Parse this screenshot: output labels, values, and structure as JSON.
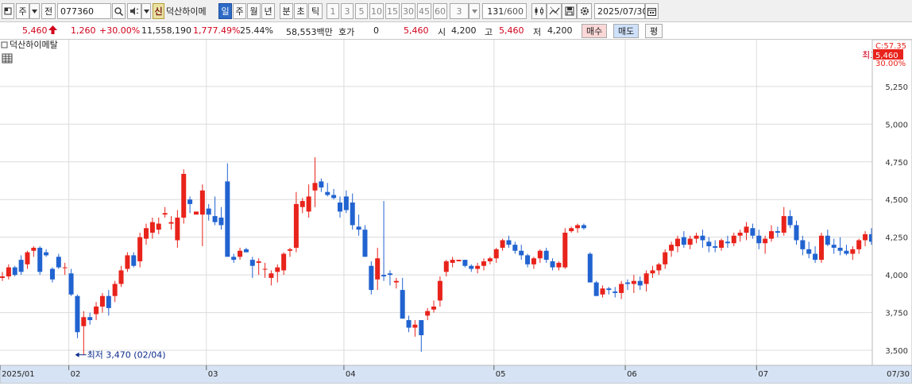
{
  "toolbar": {
    "market_label": "주",
    "code_type_label": "전",
    "code": "077360",
    "shin_label": "신",
    "stock_name": "덕산하이메",
    "periods": [
      "일",
      "주",
      "월",
      "년",
      "분",
      "초",
      "틱"
    ],
    "selected_period": "일",
    "intervals": [
      "1",
      "3",
      "5",
      "10",
      "15",
      "30",
      "45",
      "60"
    ],
    "interval_value": "3",
    "count": "131",
    "count_max": "/600",
    "date": "2025/07/30"
  },
  "quote": {
    "price": "5,460",
    "change": "1,260",
    "change_pct": "+30.00%",
    "volume": "11,558,190",
    "volume_ratio": "1,777.49%",
    "turnover": "25.44%",
    "amount": "58,553백만",
    "hoga_label": "호가",
    "hoga_value": "0",
    "hoga_price": "5,460",
    "open_label": "시",
    "open": "4,200",
    "high_label": "고",
    "high": "5,460",
    "low_label": "저",
    "low": "4,200",
    "buy_label": "매수",
    "sell_label": "매도",
    "avg_label": "평"
  },
  "colors": {
    "up": "#e8231b",
    "down": "#2163d0",
    "annot_high": "#d0021b",
    "annot_low": "#0a2a8c"
  },
  "chart_data": {
    "type": "candlestick",
    "title": "덕산하이메탈",
    "ylim": [
      3400,
      5560
    ],
    "yticks": [
      3500,
      3750,
      4000,
      4250,
      4500,
      4750,
      5000,
      5250,
      5460
    ],
    "ytick_labels": [
      "3,500",
      "3,750",
      "4,000",
      "4,250",
      "4,500",
      "4,750",
      "5,000",
      "5,250",
      "5,460"
    ],
    "right_top_labels": [
      "C:57.35",
      "30.00%"
    ],
    "current_price_label": "5,460",
    "x_month_labels": [
      {
        "label": "2025/01",
        "index": 0
      },
      {
        "label": "02",
        "index": 11
      },
      {
        "label": "03",
        "index": 33
      },
      {
        "label": "04",
        "index": 55
      },
      {
        "label": "05",
        "index": 79
      },
      {
        "label": "06",
        "index": 100
      },
      {
        "label": "07",
        "index": 121
      }
    ],
    "x_end_label": "07/30",
    "annotations": [
      {
        "text": "최고 5,460 (07/30)",
        "value": 5460,
        "index": 153,
        "side": "left"
      },
      {
        "text": "최저 3,470 (02/04)",
        "value": 3470,
        "index": 11,
        "side": "right"
      }
    ],
    "candles": [
      [
        3980,
        4020,
        3960,
        3990
      ],
      [
        3990,
        4070,
        3970,
        4050
      ],
      [
        4050,
        4060,
        3990,
        4000
      ],
      [
        4100,
        4130,
        4000,
        4020
      ],
      [
        4070,
        4160,
        4040,
        4150
      ],
      [
        4160,
        4190,
        4120,
        4180
      ],
      [
        4180,
        4190,
        4000,
        4020
      ],
      [
        4150,
        4170,
        4120,
        4130
      ],
      [
        4040,
        4050,
        3950,
        3970
      ],
      [
        4120,
        4140,
        4040,
        4050
      ],
      [
        4050,
        4080,
        4000,
        4050
      ],
      [
        4010,
        4040,
        3860,
        3870
      ],
      [
        3860,
        3870,
        3580,
        3620
      ],
      [
        3660,
        3760,
        3470,
        3720
      ],
      [
        3720,
        3750,
        3670,
        3700
      ],
      [
        3740,
        3820,
        3700,
        3790
      ],
      [
        3790,
        3880,
        3750,
        3860
      ],
      [
        3860,
        3900,
        3730,
        3780
      ],
      [
        3860,
        3960,
        3820,
        3940
      ],
      [
        3940,
        4060,
        3920,
        4030
      ],
      [
        4040,
        4150,
        4020,
        4130
      ],
      [
        4130,
        4150,
        4050,
        4060
      ],
      [
        4090,
        4280,
        4050,
        4250
      ],
      [
        4240,
        4340,
        4200,
        4310
      ],
      [
        4280,
        4380,
        4240,
        4350
      ],
      [
        4300,
        4380,
        4270,
        4340
      ],
      [
        4400,
        4450,
        4380,
        4410
      ],
      [
        4340,
        4390,
        4300,
        4350
      ],
      [
        4230,
        4430,
        4180,
        4380
      ],
      [
        4380,
        4700,
        4340,
        4670
      ],
      [
        4500,
        4520,
        4410,
        4470
      ],
      [
        4400,
        4420,
        4410,
        4420
      ],
      [
        4400,
        4600,
        4190,
        4560
      ],
      [
        4440,
        4470,
        4360,
        4400
      ],
      [
        4390,
        4520,
        4330,
        4350
      ],
      [
        4380,
        4450,
        4300,
        4330
      ],
      [
        4620,
        4740,
        4150,
        4120
      ],
      [
        4120,
        4140,
        4080,
        4100
      ],
      [
        4120,
        4180,
        4100,
        4160
      ],
      [
        4170,
        4180,
        4150,
        4150
      ],
      [
        4100,
        4120,
        3980,
        4060
      ],
      [
        4080,
        4110,
        4000,
        4090
      ],
      [
        4040,
        4080,
        3980,
        4040
      ],
      [
        3980,
        4030,
        3930,
        4010
      ],
      [
        4020,
        4070,
        3950,
        4050
      ],
      [
        4030,
        4150,
        4000,
        4140
      ],
      [
        4160,
        4180,
        4120,
        4170
      ],
      [
        4180,
        4550,
        4150,
        4470
      ],
      [
        4450,
        4510,
        4410,
        4490
      ],
      [
        4420,
        4600,
        4380,
        4520
      ],
      [
        4560,
        4780,
        4450,
        4610
      ],
      [
        4620,
        4640,
        4550,
        4580
      ],
      [
        4550,
        4610,
        4520,
        4530
      ],
      [
        4530,
        4570,
        4500,
        4510
      ],
      [
        4480,
        4520,
        4380,
        4420
      ],
      [
        4520,
        4560,
        4410,
        4430
      ],
      [
        4480,
        4540,
        4300,
        4330
      ],
      [
        4320,
        4400,
        4260,
        4300
      ],
      [
        4300,
        4330,
        4120,
        4120
      ],
      [
        4060,
        4090,
        3870,
        3900
      ],
      [
        3970,
        4180,
        3900,
        4110
      ],
      [
        4000,
        4490,
        3960,
        3990
      ],
      [
        4010,
        4030,
        3930,
        4000
      ],
      [
        3950,
        3980,
        3910,
        3960
      ],
      [
        3900,
        3980,
        3710,
        3710
      ],
      [
        3700,
        3730,
        3620,
        3650
      ],
      [
        3650,
        3700,
        3590,
        3670
      ],
      [
        3700,
        3680,
        3490,
        3600
      ],
      [
        3730,
        3780,
        3700,
        3760
      ],
      [
        3770,
        3830,
        3750,
        3790
      ],
      [
        3830,
        3990,
        3790,
        3960
      ],
      [
        4020,
        4100,
        3990,
        4090
      ],
      [
        4080,
        4120,
        4050,
        4100
      ],
      [
        4090,
        4100,
        4090,
        4100
      ],
      [
        4100,
        4100,
        4050,
        4060
      ],
      [
        4060,
        4070,
        4020,
        4040
      ],
      [
        4040,
        4080,
        4010,
        4060
      ],
      [
        4060,
        4110,
        4030,
        4090
      ],
      [
        4090,
        4120,
        4070,
        4110
      ],
      [
        4110,
        4180,
        4080,
        4170
      ],
      [
        4180,
        4240,
        4160,
        4230
      ],
      [
        4230,
        4260,
        4180,
        4200
      ],
      [
        4200,
        4220,
        4140,
        4160
      ],
      [
        4160,
        4200,
        4100,
        4130
      ],
      [
        4130,
        4140,
        4050,
        4070
      ],
      [
        4070,
        4120,
        4040,
        4110
      ],
      [
        4110,
        4170,
        4080,
        4160
      ],
      [
        4160,
        4180,
        4080,
        4100
      ],
      [
        4090,
        4110,
        4030,
        4050
      ],
      [
        4050,
        4090,
        4030,
        4080
      ],
      [
        4050,
        4310,
        4040,
        4280
      ],
      [
        4290,
        4320,
        4280,
        4310
      ],
      [
        4310,
        4340,
        4280,
        4330
      ],
      [
        4330,
        4340,
        4300,
        4310
      ],
      [
        4140,
        4150,
        3950,
        3950
      ],
      [
        3950,
        3960,
        3860,
        3860
      ],
      [
        3870,
        3930,
        3850,
        3910
      ],
      [
        3910,
        3920,
        3870,
        3900
      ],
      [
        3890,
        3920,
        3850,
        3880
      ],
      [
        3880,
        3960,
        3840,
        3940
      ],
      [
        3950,
        3970,
        3900,
        3940
      ],
      [
        3940,
        4000,
        3880,
        3960
      ],
      [
        3960,
        3990,
        3900,
        3930
      ],
      [
        3940,
        4030,
        3890,
        4010
      ],
      [
        4010,
        4060,
        3980,
        4030
      ],
      [
        4030,
        4080,
        4000,
        4070
      ],
      [
        4070,
        4170,
        4040,
        4150
      ],
      [
        4160,
        4220,
        4120,
        4200
      ],
      [
        4190,
        4260,
        4150,
        4240
      ],
      [
        4250,
        4290,
        4180,
        4200
      ],
      [
        4200,
        4260,
        4170,
        4240
      ],
      [
        4240,
        4280,
        4210,
        4260
      ],
      [
        4260,
        4300,
        4180,
        4230
      ],
      [
        4220,
        4250,
        4150,
        4190
      ],
      [
        4190,
        4230,
        4150,
        4180
      ],
      [
        4180,
        4240,
        4160,
        4230
      ],
      [
        4220,
        4260,
        4180,
        4210
      ],
      [
        4210,
        4280,
        4190,
        4260
      ],
      [
        4260,
        4300,
        4220,
        4280
      ],
      [
        4280,
        4350,
        4230,
        4320
      ],
      [
        4310,
        4340,
        4240,
        4260
      ],
      [
        4260,
        4300,
        4170,
        4210
      ],
      [
        4210,
        4260,
        4140,
        4240
      ],
      [
        4240,
        4330,
        4220,
        4290
      ],
      [
        4290,
        4320,
        4250,
        4280
      ],
      [
        4280,
        4450,
        4260,
        4390
      ],
      [
        4390,
        4430,
        4310,
        4330
      ],
      [
        4330,
        4360,
        4200,
        4230
      ],
      [
        4230,
        4260,
        4130,
        4170
      ],
      [
        4170,
        4220,
        4110,
        4140
      ],
      [
        4140,
        4190,
        4080,
        4100
      ],
      [
        4100,
        4280,
        4080,
        4260
      ],
      [
        4260,
        4300,
        4190,
        4200
      ],
      [
        4200,
        4240,
        4140,
        4180
      ],
      [
        4180,
        4250,
        4130,
        4160
      ],
      [
        4160,
        4200,
        4130,
        4140
      ],
      [
        4140,
        4190,
        4100,
        4170
      ],
      [
        4170,
        4240,
        4140,
        4230
      ],
      [
        4230,
        4290,
        4190,
        4270
      ],
      [
        4270,
        4310,
        4200,
        4220
      ],
      [
        4220,
        4270,
        4180,
        4250
      ],
      [
        4250,
        4300,
        4220,
        4280
      ],
      [
        4280,
        4330,
        4240,
        4300
      ],
      [
        4300,
        4340,
        4250,
        4270
      ],
      [
        4270,
        4310,
        4200,
        4220
      ],
      [
        4220,
        4250,
        4100,
        4130
      ],
      [
        4140,
        4180,
        4110,
        4120
      ],
      [
        4120,
        4160,
        4090,
        4140
      ],
      [
        4140,
        4200,
        4120,
        4160
      ],
      [
        4160,
        4290,
        4140,
        4270
      ],
      [
        4200,
        4290,
        4160,
        4200
      ],
      [
        4200,
        5460,
        4200,
        5460
      ]
    ]
  }
}
